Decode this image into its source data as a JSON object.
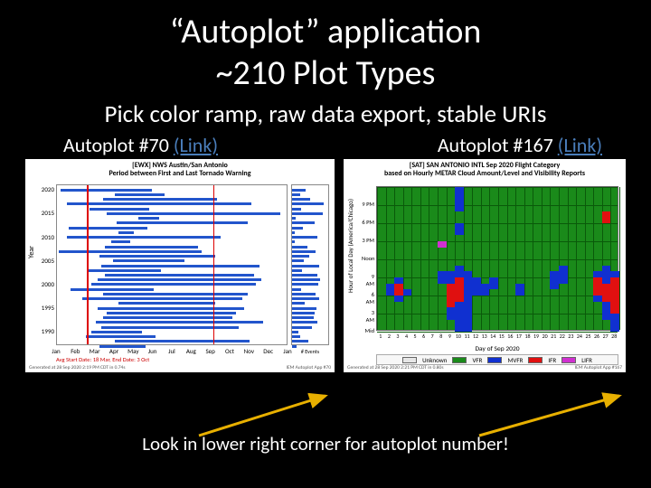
{
  "title_line1": "“Autoplot” application",
  "title_line2": "~210 Plot Types",
  "subtitle": "Pick color ramp, raw data export, stable URIs",
  "left_caption": {
    "label": "Autoplot #70 ",
    "link": "(Link)"
  },
  "right_caption": {
    "label": "Autoplot #167 ",
    "link": "(Link)"
  },
  "bottom_caption": "Look in lower right corner for autoplot number!",
  "chart_data": [
    {
      "id": "autoplot-70",
      "type": "bar",
      "orientation": "horizontal",
      "title_lines": [
        "[EWX] NWS Austin/San Antonio",
        "Period between First and Last Tornado Warning"
      ],
      "ylabel": "Year",
      "xlabel": "",
      "x_categories": [
        "Jan",
        "Feb",
        "Mar",
        "Apr",
        "May",
        "Jun",
        "Jul",
        "Aug",
        "Sep",
        "Oct",
        "Nov",
        "Dec",
        "Jan"
      ],
      "y_ticks": [
        1990,
        1995,
        2000,
        2005,
        2010,
        2015,
        2020
      ],
      "ylim": [
        1987,
        2021
      ],
      "series": [
        {
          "year": 1987,
          "start": 3.2,
          "end": 5.6
        },
        {
          "year": 1988,
          "start": 4.0,
          "end": 11.0
        },
        {
          "year": 1989,
          "start": 2.5,
          "end": 6.1
        },
        {
          "year": 1990,
          "start": 2.8,
          "end": 5.4
        },
        {
          "year": 1991,
          "start": 3.3,
          "end": 10.4
        },
        {
          "year": 1992,
          "start": 3.0,
          "end": 11.7
        },
        {
          "year": 1993,
          "start": 3.4,
          "end": 10.1
        },
        {
          "year": 1994,
          "start": 3.6,
          "end": 10.3
        },
        {
          "year": 1995,
          "start": 3.1,
          "end": 10.7
        },
        {
          "year": 1996,
          "start": 4.2,
          "end": 9.2
        },
        {
          "year": 1997,
          "start": 2.3,
          "end": 10.6
        },
        {
          "year": 1998,
          "start": 3.4,
          "end": 10.9
        },
        {
          "year": 1999,
          "start": 1.7,
          "end": 6.0
        },
        {
          "year": 2000,
          "start": 2.8,
          "end": 11.3
        },
        {
          "year": 2001,
          "start": 3.1,
          "end": 11.6
        },
        {
          "year": 2002,
          "start": 3.5,
          "end": 11.2
        },
        {
          "year": 2003,
          "start": 2.6,
          "end": 6.4
        },
        {
          "year": 2004,
          "start": 3.3,
          "end": 11.5
        },
        {
          "year": 2005,
          "start": 3.9,
          "end": 7.6
        },
        {
          "year": 2006,
          "start": 3.2,
          "end": 9.2
        },
        {
          "year": 2007,
          "start": 1.1,
          "end": 8.5
        },
        {
          "year": 2008,
          "start": 3.5,
          "end": 8.3
        },
        {
          "year": 2009,
          "start": 3.8,
          "end": 4.8
        },
        {
          "year": 2010,
          "start": 1.5,
          "end": 9.5
        },
        {
          "year": 2011,
          "start": 4.2,
          "end": 5.0
        },
        {
          "year": 2012,
          "start": 1.6,
          "end": 5.7
        },
        {
          "year": 2013,
          "start": 4.1,
          "end": 10.9
        },
        {
          "year": 2014,
          "start": 5.2,
          "end": 6.3
        },
        {
          "year": 2015,
          "start": 3.6,
          "end": 12.6
        },
        {
          "year": 2016,
          "start": 2.7,
          "end": 5.8
        },
        {
          "year": 2017,
          "start": 1.5,
          "end": 11.1
        },
        {
          "year": 2018,
          "start": 3.4,
          "end": 9.3
        },
        {
          "year": 2019,
          "start": 4.0,
          "end": 6.6
        },
        {
          "year": 2020,
          "start": 1.2,
          "end": 5.9
        }
      ],
      "avg_start_month": 2.55,
      "avg_end_month": 9.1,
      "avg_label": "Avg Start Date: 18 Mar, End Date: 3 Oct",
      "side_histogram": {
        "xlabel": "# Events",
        "ticks": [
          0,
          20,
          40
        ],
        "values_by_year": [
          5,
          18,
          9,
          7,
          22,
          28,
          24,
          25,
          27,
          14,
          30,
          26,
          10,
          29,
          31,
          28,
          11,
          30,
          13,
          19,
          26,
          17,
          3,
          28,
          3,
          12,
          25,
          4,
          34,
          10,
          35,
          20,
          9,
          15
        ]
      },
      "footer_left": "Generated at 28 Sep 2020 2:19 PM CDT in 0.74s",
      "footer_right": "IEM Autoplot App #70"
    },
    {
      "id": "autoplot-167",
      "type": "heatmap",
      "title_lines": [
        "[SAT] SAN ANTONIO INTL Sep 2020 Flight Category",
        "based on Hourly METAR Cloud Amount/Level and Visibility Reports"
      ],
      "ylabel": "Hour of Local Day (America/Chicago)",
      "xlabel": "Day of Sep 2020",
      "x_ticks": [
        1,
        2,
        3,
        4,
        5,
        6,
        7,
        8,
        9,
        10,
        11,
        12,
        13,
        14,
        15,
        16,
        17,
        18,
        19,
        20,
        21,
        22,
        23,
        24,
        25,
        26,
        27,
        28
      ],
      "y_ticks_labels": [
        "Mid",
        "3 AM",
        "6 AM",
        "9 AM",
        "Noon",
        "3 PM",
        "6 PM",
        "9 PM"
      ],
      "y_ticks_hours": [
        0,
        3,
        6,
        9,
        12,
        15,
        18,
        21
      ],
      "categories": {
        "Unknown": "#e6e6e6",
        "VFR": "#1a8a1a",
        "MVFR": "#1030d0",
        "IFR": "#e01010",
        "LIFR": "#d030d0"
      },
      "legend": [
        "Unknown",
        "VFR",
        "MVFR",
        "IFR",
        "LIFR"
      ],
      "non_vfr_cells": [
        {
          "day": 2,
          "hour": 6,
          "cat": "MVFR"
        },
        {
          "day": 2,
          "hour": 7,
          "cat": "MVFR"
        },
        {
          "day": 3,
          "hour": 5,
          "cat": "MVFR"
        },
        {
          "day": 3,
          "hour": 6,
          "cat": "IFR"
        },
        {
          "day": 3,
          "hour": 7,
          "cat": "IFR"
        },
        {
          "day": 3,
          "hour": 8,
          "cat": "MVFR"
        },
        {
          "day": 4,
          "hour": 6,
          "cat": "MVFR"
        },
        {
          "day": 8,
          "hour": 8,
          "cat": "MVFR"
        },
        {
          "day": 8,
          "hour": 9,
          "cat": "MVFR"
        },
        {
          "day": 8,
          "hour": 14,
          "cat": "LIFR"
        },
        {
          "day": 9,
          "hour": 2,
          "cat": "MVFR"
        },
        {
          "day": 9,
          "hour": 3,
          "cat": "MVFR"
        },
        {
          "day": 9,
          "hour": 4,
          "cat": "IFR"
        },
        {
          "day": 9,
          "hour": 5,
          "cat": "IFR"
        },
        {
          "day": 9,
          "hour": 6,
          "cat": "IFR"
        },
        {
          "day": 9,
          "hour": 7,
          "cat": "IFR"
        },
        {
          "day": 9,
          "hour": 8,
          "cat": "MVFR"
        },
        {
          "day": 9,
          "hour": 9,
          "cat": "MVFR"
        },
        {
          "day": 10,
          "hour": 0,
          "cat": "MVFR"
        },
        {
          "day": 10,
          "hour": 1,
          "cat": "MVFR"
        },
        {
          "day": 10,
          "hour": 2,
          "cat": "MVFR"
        },
        {
          "day": 10,
          "hour": 3,
          "cat": "MVFR"
        },
        {
          "day": 10,
          "hour": 4,
          "cat": "MVFR"
        },
        {
          "day": 10,
          "hour": 5,
          "cat": "IFR"
        },
        {
          "day": 10,
          "hour": 6,
          "cat": "IFR"
        },
        {
          "day": 10,
          "hour": 7,
          "cat": "IFR"
        },
        {
          "day": 10,
          "hour": 8,
          "cat": "IFR"
        },
        {
          "day": 10,
          "hour": 9,
          "cat": "MVFR"
        },
        {
          "day": 10,
          "hour": 10,
          "cat": "MVFR"
        },
        {
          "day": 10,
          "hour": 16,
          "cat": "MVFR"
        },
        {
          "day": 10,
          "hour": 17,
          "cat": "MVFR"
        },
        {
          "day": 10,
          "hour": 20,
          "cat": "MVFR"
        },
        {
          "day": 10,
          "hour": 21,
          "cat": "MVFR"
        },
        {
          "day": 10,
          "hour": 22,
          "cat": "MVFR"
        },
        {
          "day": 10,
          "hour": 23,
          "cat": "MVFR"
        },
        {
          "day": 11,
          "hour": 0,
          "cat": "MVFR"
        },
        {
          "day": 11,
          "hour": 1,
          "cat": "MVFR"
        },
        {
          "day": 11,
          "hour": 2,
          "cat": "MVFR"
        },
        {
          "day": 11,
          "hour": 3,
          "cat": "MVFR"
        },
        {
          "day": 11,
          "hour": 4,
          "cat": "MVFR"
        },
        {
          "day": 11,
          "hour": 5,
          "cat": "MVFR"
        },
        {
          "day": 11,
          "hour": 6,
          "cat": "MVFR"
        },
        {
          "day": 11,
          "hour": 7,
          "cat": "MVFR"
        },
        {
          "day": 11,
          "hour": 8,
          "cat": "MVFR"
        },
        {
          "day": 11,
          "hour": 9,
          "cat": "MVFR"
        },
        {
          "day": 12,
          "hour": 6,
          "cat": "MVFR"
        },
        {
          "day": 12,
          "hour": 7,
          "cat": "MVFR"
        },
        {
          "day": 12,
          "hour": 8,
          "cat": "MVFR"
        },
        {
          "day": 13,
          "hour": 6,
          "cat": "MVFR"
        },
        {
          "day": 13,
          "hour": 7,
          "cat": "MVFR"
        },
        {
          "day": 14,
          "hour": 7,
          "cat": "MVFR"
        },
        {
          "day": 14,
          "hour": 8,
          "cat": "MVFR"
        },
        {
          "day": 17,
          "hour": 6,
          "cat": "MVFR"
        },
        {
          "day": 17,
          "hour": 7,
          "cat": "MVFR"
        },
        {
          "day": 21,
          "hour": 7,
          "cat": "MVFR"
        },
        {
          "day": 21,
          "hour": 8,
          "cat": "MVFR"
        },
        {
          "day": 21,
          "hour": 9,
          "cat": "MVFR"
        },
        {
          "day": 22,
          "hour": 8,
          "cat": "MVFR"
        },
        {
          "day": 22,
          "hour": 9,
          "cat": "MVFR"
        },
        {
          "day": 22,
          "hour": 10,
          "cat": "MVFR"
        },
        {
          "day": 26,
          "hour": 5,
          "cat": "MVFR"
        },
        {
          "day": 26,
          "hour": 6,
          "cat": "IFR"
        },
        {
          "day": 26,
          "hour": 7,
          "cat": "IFR"
        },
        {
          "day": 26,
          "hour": 8,
          "cat": "IFR"
        },
        {
          "day": 26,
          "hour": 9,
          "cat": "MVFR"
        },
        {
          "day": 27,
          "hour": 2,
          "cat": "MVFR"
        },
        {
          "day": 27,
          "hour": 3,
          "cat": "MVFR"
        },
        {
          "day": 27,
          "hour": 4,
          "cat": "MVFR"
        },
        {
          "day": 27,
          "hour": 5,
          "cat": "IFR"
        },
        {
          "day": 27,
          "hour": 6,
          "cat": "IFR"
        },
        {
          "day": 27,
          "hour": 7,
          "cat": "IFR"
        },
        {
          "day": 27,
          "hour": 8,
          "cat": "MVFR"
        },
        {
          "day": 27,
          "hour": 9,
          "cat": "MVFR"
        },
        {
          "day": 27,
          "hour": 10,
          "cat": "MVFR"
        },
        {
          "day": 27,
          "hour": 18,
          "cat": "IFR"
        },
        {
          "day": 27,
          "hour": 19,
          "cat": "IFR"
        },
        {
          "day": 28,
          "hour": 0,
          "cat": "MVFR"
        },
        {
          "day": 28,
          "hour": 1,
          "cat": "MVFR"
        },
        {
          "day": 28,
          "hour": 2,
          "cat": "MVFR"
        },
        {
          "day": 28,
          "hour": 3,
          "cat": "IFR"
        },
        {
          "day": 28,
          "hour": 4,
          "cat": "IFR"
        },
        {
          "day": 28,
          "hour": 5,
          "cat": "IFR"
        },
        {
          "day": 28,
          "hour": 6,
          "cat": "IFR"
        },
        {
          "day": 28,
          "hour": 7,
          "cat": "IFR"
        },
        {
          "day": 28,
          "hour": 8,
          "cat": "IFR"
        },
        {
          "day": 28,
          "hour": 9,
          "cat": "MVFR"
        }
      ],
      "footer_left": "Generated at 28 Sep 2020 2:21 PM CDT in 0.80s",
      "footer_right": "IEM Autoplot App #167"
    }
  ]
}
